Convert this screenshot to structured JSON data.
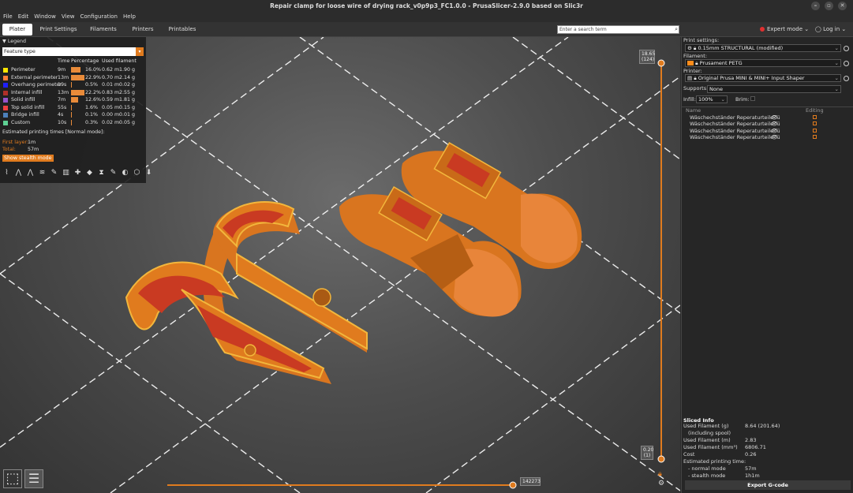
{
  "window": {
    "title": "Repair clamp for loose wire of drying rack_v0p9p3_FC1.0.0 - PrusaSlicer-2.9.0 based on Slic3r"
  },
  "menu": [
    "File",
    "Edit",
    "Window",
    "View",
    "Configuration",
    "Help"
  ],
  "tabs": [
    "Plater",
    "Print Settings",
    "Filaments",
    "Printers",
    "Printables"
  ],
  "search": {
    "placeholder": "Enter a search term"
  },
  "mode": {
    "label": "Expert mode"
  },
  "login": {
    "label": "Log in"
  },
  "legend": {
    "title": "Legend",
    "feature_type": "Feature type",
    "columns": [
      "Time",
      "Percentage",
      "Used filament"
    ],
    "rows": [
      {
        "name": "Perimeter",
        "time": "9m",
        "percent": "16.0%",
        "m": "0.62 m",
        "g": "1.90 g",
        "color": "#ffe600",
        "pct_value": 16.0
      },
      {
        "name": "External perimeter",
        "time": "13m",
        "percent": "22.9%",
        "m": "0.70 m",
        "g": "2.14 g",
        "color": "#ff7d38",
        "pct_value": 22.9
      },
      {
        "name": "Overhang perimeter",
        "time": "19s",
        "percent": "0.5%",
        "m": "0.01 m",
        "g": "0.02 g",
        "color": "#1f1fff",
        "pct_value": 0.5
      },
      {
        "name": "Internal infill",
        "time": "13m",
        "percent": "22.2%",
        "m": "0.83 m",
        "g": "2.55 g",
        "color": "#b03029",
        "pct_value": 22.2
      },
      {
        "name": "Solid infill",
        "time": "7m",
        "percent": "12.6%",
        "m": "0.59 m",
        "g": "1.81 g",
        "color": "#9654cc",
        "pct_value": 12.6
      },
      {
        "name": "Top solid infill",
        "time": "55s",
        "percent": "1.6%",
        "m": "0.05 m",
        "g": "0.15 g",
        "color": "#f04040",
        "pct_value": 1.6
      },
      {
        "name": "Bridge infill",
        "time": "4s",
        "percent": "0.1%",
        "m": "0.00 m",
        "g": "0.01 g",
        "color": "#4d80ba",
        "pct_value": 0.1
      },
      {
        "name": "Custom",
        "time": "10s",
        "percent": "0.3%",
        "m": "0.02 m",
        "g": "0.05 g",
        "color": "#5ed194",
        "pct_value": 0.3
      }
    ],
    "estimated": "Estimated printing times [Normal mode]:",
    "first_layer_label": "First layer:",
    "first_layer_value": "1m",
    "total_label": "Total:",
    "total_value": "57m",
    "stealth_button": "Show stealth mode"
  },
  "right_panel": {
    "print_settings_label": "Print settings:",
    "print_settings_value": "0.15mm STRUCTURAL (modified)",
    "filament_label": "Filament:",
    "filament_value": "Prusament PETG",
    "filament_color": "#ff8c1a",
    "printer_label": "Printer:",
    "printer_value": "Original Prusa MINI & MINI+ Input Shaper",
    "supports_label": "Supports:",
    "supports_value": "None",
    "infill_label": "Infill:",
    "infill_value": "100%",
    "brim_label": "Brim:",
    "object_list_headers": [
      "Name",
      "Editing"
    ],
    "objects": [
      "Wäschechständer Reperaturteile fü",
      "Wäschechständer Reperaturteile fü",
      "Wäschechständer Reperaturteile fü",
      "Wäschechständer Reperaturteile fü"
    ],
    "sliced_info_title": "Sliced Info",
    "sliced_info": [
      {
        "label": "Used Filament (g)",
        "value": "8.64 (201.64)"
      },
      {
        "label": "(including spool)",
        "value": ""
      },
      {
        "label": "Used Filament (m)",
        "value": "2.83"
      },
      {
        "label": "Used Filament (mm³)",
        "value": "6806.71"
      },
      {
        "label": "Cost",
        "value": "0.26"
      },
      {
        "label": "Estimated printing time:",
        "value": ""
      },
      {
        "label": "- normal mode",
        "value": "57m"
      },
      {
        "label": "- stealth mode",
        "value": "1h1m"
      }
    ],
    "export_button": "Export G-code"
  },
  "sliders": {
    "top_height": "18.65",
    "top_layer": "(124)",
    "bottom_height": "0.20",
    "bottom_layer": "(1)",
    "horizontal_value": "142273"
  }
}
